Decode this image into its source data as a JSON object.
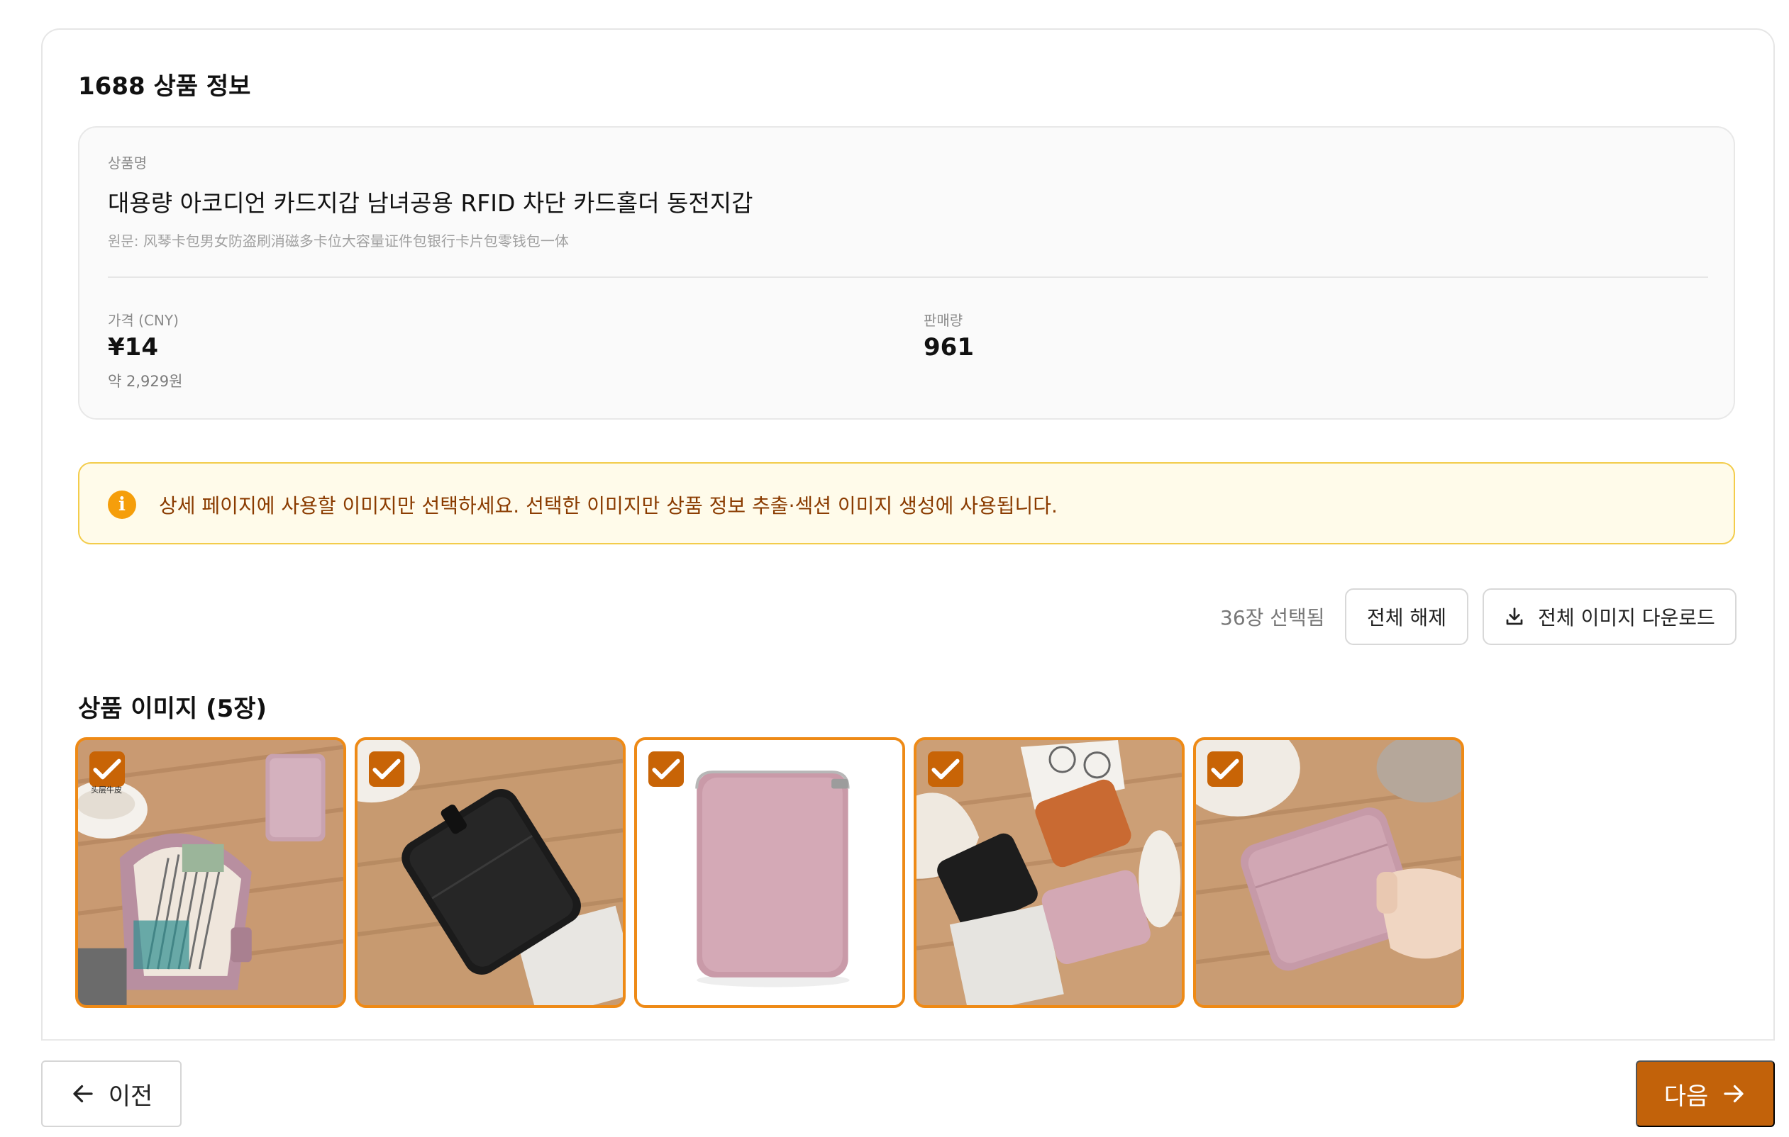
{
  "section_title": "1688 상품 정보",
  "product": {
    "name_label": "상품명",
    "name": "대용량 아코디언 카드지갑 남녀공용 RFID 차단 카드홀더 동전지갑",
    "original": "원문: 风琴卡包男女防盗刷消磁多卡位大容量证件包银行卡片包零钱包一体",
    "price_label": "가격 (CNY)",
    "price": "¥14",
    "price_krw": "약 2,929원",
    "sales_label": "판매량",
    "sales": "961"
  },
  "notice": {
    "icon": "info-icon",
    "text": "상세 페이지에 사용할 이미지만 선택하세요. 선택한 이미지만 상품 정보 추출·섹션 이미지 생성에 사용됩니다."
  },
  "selection": {
    "count_text": "36장 선택됨",
    "deselect_all_label": "전체 해제",
    "download_all_label": "전체 이미지 다운로드"
  },
  "images": {
    "title": "상품 이미지 (5장)",
    "items": [
      {
        "alt": "open accordion card wallet with cards",
        "selected": true,
        "overlay_text": "头层牛皮"
      },
      {
        "alt": "black leather zip card wallet",
        "selected": true
      },
      {
        "alt": "pink leather zip wallet on white",
        "selected": true
      },
      {
        "alt": "black orange and pink wallets on table",
        "selected": true
      },
      {
        "alt": "hand holding pink zip wallet",
        "selected": true
      }
    ]
  },
  "footer": {
    "prev_label": "이전",
    "next_label": "다음"
  },
  "colors": {
    "accent": "#c2620a",
    "selection_border": "#ee8a16",
    "notice_bg": "#fffbea",
    "notice_border": "#f3cc4b",
    "notice_text": "#8a3b00",
    "info_icon": "#f59e0b"
  }
}
